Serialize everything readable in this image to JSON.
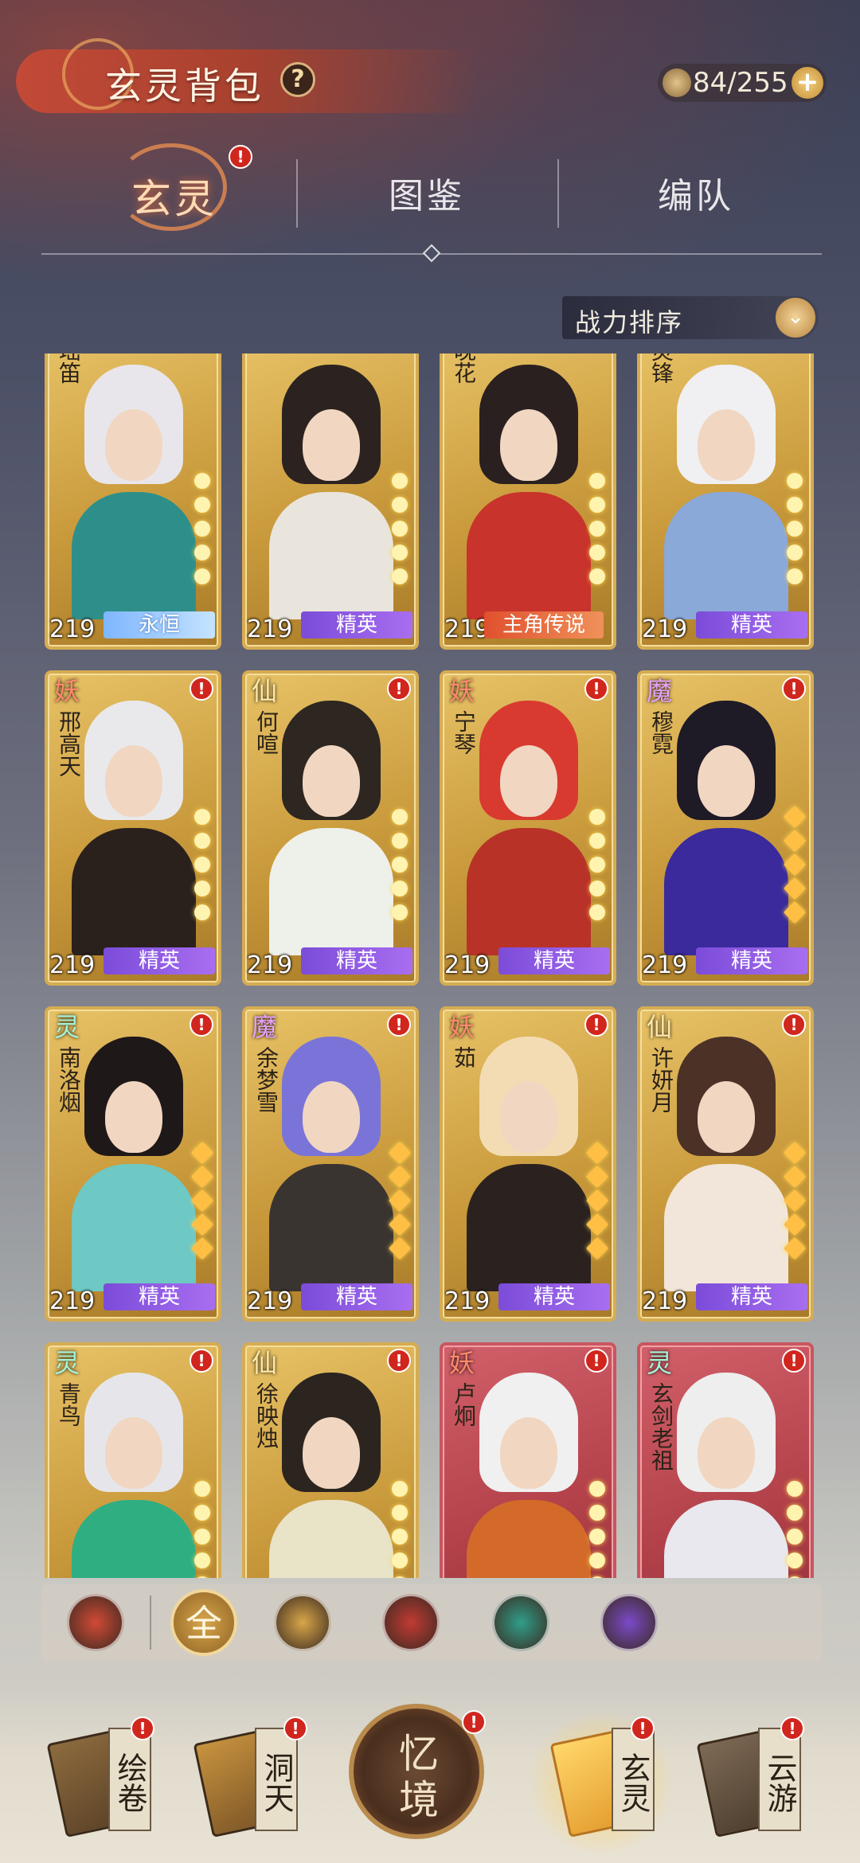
{
  "header": {
    "title": "玄灵背包",
    "help_icon": "?",
    "capacity": "84/255",
    "add_icon": "+"
  },
  "tabs": [
    {
      "label": "玄灵",
      "active": true
    },
    {
      "label": "图鉴"
    },
    {
      "label": "编队"
    }
  ],
  "sort": {
    "label": "战力排序",
    "icon": "chevron-double-down-icon"
  },
  "badge_text": "!",
  "cards": [
    {
      "faction": "",
      "name": "瑶笛",
      "level": "219",
      "rarity": "永恒",
      "rarity_type": "eternal",
      "style": "gold",
      "badge": false,
      "colors": [
        "#e8e6ea",
        "#2e8f8a"
      ]
    },
    {
      "faction": "",
      "name": "",
      "level": "219",
      "rarity": "精英",
      "rarity_type": "elite",
      "style": "gold",
      "badge": false,
      "colors": [
        "#2c2320",
        "#e9e5dd"
      ]
    },
    {
      "faction": "",
      "name": "晚花",
      "level": "219",
      "rarity": "主角传说",
      "rarity_type": "legend",
      "style": "gold",
      "badge": false,
      "colors": [
        "#2b2020",
        "#c8332b"
      ]
    },
    {
      "faction": "",
      "name": "灵锋",
      "level": "219",
      "rarity": "精英",
      "rarity_type": "elite",
      "style": "gold",
      "badge": false,
      "colors": [
        "#f0f0f2",
        "#8aa8d8"
      ]
    },
    {
      "faction": "妖",
      "faction_type": "yao",
      "name": "邢高天",
      "level": "219",
      "rarity": "精英",
      "rarity_type": "elite",
      "style": "gold",
      "badge": true,
      "colors": [
        "#e9e9ec",
        "#2a211d"
      ]
    },
    {
      "faction": "仙",
      "faction_type": "xian",
      "name": "何喧",
      "level": "219",
      "rarity": "精英",
      "rarity_type": "elite",
      "style": "gold",
      "badge": true,
      "colors": [
        "#2d2621",
        "#eef0ea"
      ]
    },
    {
      "faction": "妖",
      "faction_type": "yao",
      "name": "宁琴",
      "level": "219",
      "rarity": "精英",
      "rarity_type": "elite",
      "style": "gold",
      "badge": true,
      "colors": [
        "#d83a30",
        "#b83228"
      ]
    },
    {
      "faction": "魔",
      "faction_type": "mo",
      "name": "穆霓",
      "level": "219",
      "rarity": "精英",
      "rarity_type": "elite",
      "style": "gold",
      "badge": true,
      "colors": [
        "#1e1a26",
        "#3a2a9c"
      ]
    },
    {
      "faction": "灵",
      "faction_type": "ling",
      "name": "南洛烟",
      "level": "219",
      "rarity": "精英",
      "rarity_type": "elite",
      "style": "gold",
      "badge": true,
      "colors": [
        "#1f1818",
        "#6ec8c4"
      ]
    },
    {
      "faction": "魔",
      "faction_type": "mo",
      "name": "余梦雪",
      "level": "219",
      "rarity": "精英",
      "rarity_type": "elite",
      "style": "gold",
      "badge": true,
      "colors": [
        "#7a74d8",
        "#3a3430"
      ]
    },
    {
      "faction": "妖",
      "faction_type": "yao",
      "name": "茹",
      "level": "219",
      "rarity": "精英",
      "rarity_type": "elite",
      "style": "gold",
      "badge": true,
      "colors": [
        "#f3dcb4",
        "#2b2220"
      ]
    },
    {
      "faction": "仙",
      "faction_type": "xian",
      "name": "许妍月",
      "level": "219",
      "rarity": "精英",
      "rarity_type": "elite",
      "style": "gold",
      "badge": true,
      "colors": [
        "#4b3126",
        "#f2e6da"
      ]
    },
    {
      "faction": "灵",
      "faction_type": "ling",
      "name": "青鸟",
      "level": "",
      "rarity": "",
      "rarity_type": "",
      "style": "gold",
      "badge": true,
      "colors": [
        "#e6e6ea",
        "#2fae82"
      ]
    },
    {
      "faction": "仙",
      "faction_type": "xian",
      "name": "徐映烛",
      "level": "",
      "rarity": "",
      "rarity_type": "",
      "style": "gold",
      "badge": true,
      "colors": [
        "#2c241f",
        "#e9e3c8"
      ]
    },
    {
      "faction": "妖",
      "faction_type": "yao",
      "name": "卢炯",
      "level": "",
      "rarity": "",
      "rarity_type": "",
      "style": "red",
      "badge": true,
      "colors": [
        "#f0f0f0",
        "#d46a2a"
      ]
    },
    {
      "faction": "灵",
      "faction_type": "ling",
      "name": "玄剑老祖",
      "level": "",
      "rarity": "",
      "rarity_type": "",
      "style": "red",
      "badge": true,
      "colors": [
        "#eeeeee",
        "#e8e8ee"
      ]
    }
  ],
  "filters": [
    {
      "label": "",
      "icon": "triangle-faction-icon",
      "color": "#d24a36"
    },
    {
      "label": "全",
      "icon": "all-icon",
      "color": "#c8953f"
    },
    {
      "label": "",
      "icon": "lotus-icon",
      "color": "#d9a74a"
    },
    {
      "label": "",
      "icon": "spider-icon",
      "color": "#c23a34"
    },
    {
      "label": "",
      "icon": "flame-spirit-icon",
      "color": "#2f9e89"
    },
    {
      "label": "",
      "icon": "demon-icon",
      "color": "#7a4ac9"
    }
  ],
  "nav": [
    {
      "label": "绘卷"
    },
    {
      "label": "洞天"
    },
    {
      "label": "忆境"
    },
    {
      "label": "玄灵"
    },
    {
      "label": "云游"
    }
  ]
}
